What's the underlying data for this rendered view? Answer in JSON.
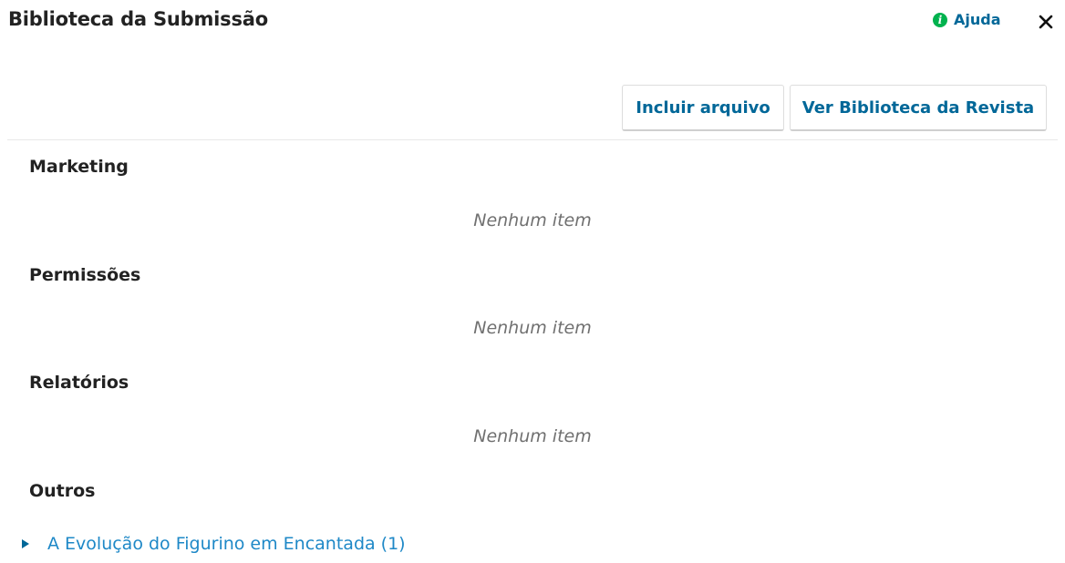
{
  "header": {
    "title": "Biblioteca da Submissão",
    "help_label": "Ajuda",
    "help_icon": "info-circle-icon",
    "close_icon": "close-icon"
  },
  "toolbar": {
    "add_file_label": "Incluir arquivo",
    "journal_library_label": "Ver Biblioteca da Revista"
  },
  "categories": [
    {
      "name": "Marketing",
      "empty_text": "Nenhum item"
    },
    {
      "name": "Permissões",
      "empty_text": "Nenhum item"
    },
    {
      "name": "Relatórios",
      "empty_text": "Nenhum item"
    },
    {
      "name": "Outros",
      "items": [
        {
          "label": "A Evolução do Figurino em Encantada (1)"
        }
      ]
    }
  ],
  "colors": {
    "accent": "#006798",
    "link": "#1e88c7",
    "help_icon": "#00b24e",
    "muted_text": "#707070"
  }
}
